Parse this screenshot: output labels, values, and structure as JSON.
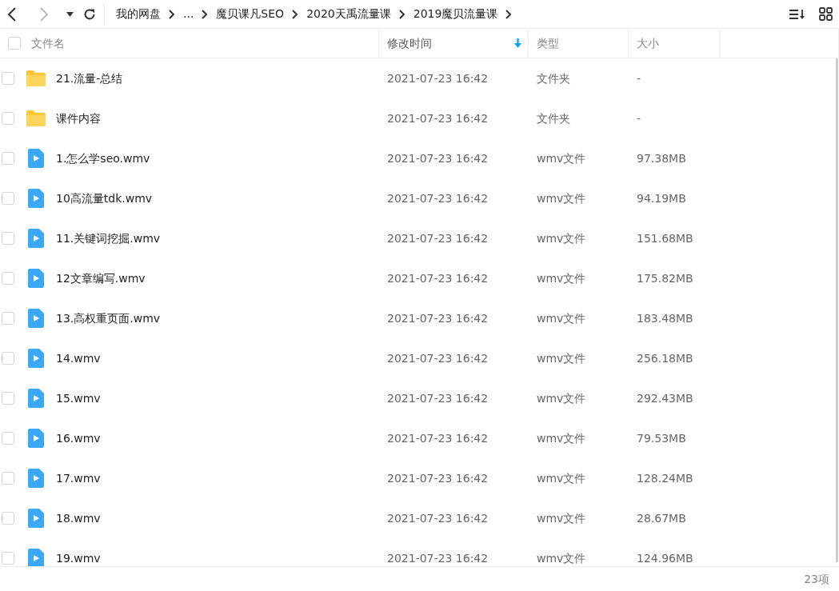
{
  "toolbar": {
    "breadcrumb": [
      "我的网盘",
      "...",
      "魔贝课凡SEO",
      "2020天禹流量课",
      "2019魔贝流量课"
    ]
  },
  "table": {
    "select_all_checked": false,
    "columns": [
      {
        "label": "文件名",
        "sorted": false
      },
      {
        "label": "修改时间",
        "sorted": true
      },
      {
        "label": "类型",
        "sorted": false
      },
      {
        "label": "大小",
        "sorted": false
      }
    ],
    "rows": [
      {
        "kind": "folder",
        "name": "21.流量-总结",
        "modified": "2021-07-23 16:42",
        "type": "文件夹",
        "size": "-",
        "checked": false
      },
      {
        "kind": "folder",
        "name": "课件内容",
        "modified": "2021-07-23 16:42",
        "type": "文件夹",
        "size": "-",
        "checked": false
      },
      {
        "kind": "video",
        "name": "1.怎么学seo.wmv",
        "modified": "2021-07-23 16:42",
        "type": "wmv文件",
        "size": "97.38MB",
        "checked": false
      },
      {
        "kind": "video",
        "name": "10高流量tdk.wmv",
        "modified": "2021-07-23 16:42",
        "type": "wmv文件",
        "size": "94.19MB",
        "checked": false
      },
      {
        "kind": "video",
        "name": "11.关键词挖掘.wmv",
        "modified": "2021-07-23 16:42",
        "type": "wmv文件",
        "size": "151.68MB",
        "checked": false
      },
      {
        "kind": "video",
        "name": "12文章编写.wmv",
        "modified": "2021-07-23 16:42",
        "type": "wmv文件",
        "size": "175.82MB",
        "checked": false
      },
      {
        "kind": "video",
        "name": "13.高权重页面.wmv",
        "modified": "2021-07-23 16:42",
        "type": "wmv文件",
        "size": "183.48MB",
        "checked": false
      },
      {
        "kind": "video",
        "name": "14.wmv",
        "modified": "2021-07-23 16:42",
        "type": "wmv文件",
        "size": "256.18MB",
        "checked": false
      },
      {
        "kind": "video",
        "name": "15.wmv",
        "modified": "2021-07-23 16:42",
        "type": "wmv文件",
        "size": "292.43MB",
        "checked": false
      },
      {
        "kind": "video",
        "name": "16.wmv",
        "modified": "2021-07-23 16:42",
        "type": "wmv文件",
        "size": "79.53MB",
        "checked": false
      },
      {
        "kind": "video",
        "name": "17.wmv",
        "modified": "2021-07-23 16:42",
        "type": "wmv文件",
        "size": "128.24MB",
        "checked": false
      },
      {
        "kind": "video",
        "name": "18.wmv",
        "modified": "2021-07-23 16:42",
        "type": "wmv文件",
        "size": "28.67MB",
        "checked": false
      },
      {
        "kind": "video",
        "name": "19.wmv",
        "modified": "2021-07-23 16:42",
        "type": "wmv文件",
        "size": "124.96MB",
        "checked": false
      }
    ]
  },
  "status_bar": {
    "count": "23项"
  }
}
